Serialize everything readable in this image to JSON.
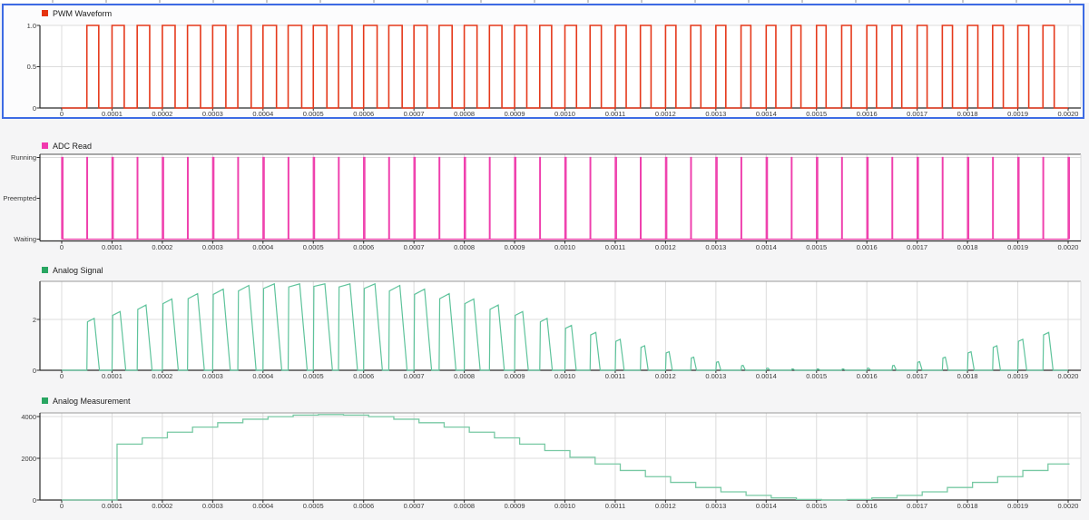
{
  "selection": {
    "selected_panel": "PWM Waveform",
    "border_color": "#3d6be4"
  },
  "colors": {
    "page_bg": "#f5f5f6",
    "plot_bg": "#ffffff",
    "selected_card_bg": "#fcfcfd",
    "grid": "#dcdcdc",
    "axis": "#2b2b2b",
    "tick_text": "#3a3a3a",
    "legend_text": "#1c1c1c"
  },
  "x_axis": {
    "t0": 0,
    "step": 0.0001,
    "t_end": 0.002,
    "labels": [
      "0",
      "0.0001",
      "0.0002",
      "0.0003",
      "0.0004",
      "0.0005",
      "0.0006",
      "0.0007",
      "0.0008",
      "0.0009",
      "0.0010",
      "0.0011",
      "0.0012",
      "0.0013",
      "0.0014",
      "0.0015",
      "0.0016",
      "0.0017",
      "0.0018",
      "0.0019",
      "0.0020"
    ]
  },
  "chart_data": [
    {
      "type": "digital-pwm",
      "title": "PWM Waveform",
      "series_color": "#e5391b",
      "legend_marker_color": "#e5330f",
      "selected": true,
      "ylim": [
        0,
        1
      ],
      "y_ticks": [
        {
          "label": "1.0",
          "v": 1
        },
        {
          "label": "0.5",
          "v": 0.5
        },
        {
          "label": "0",
          "v": 0
        }
      ],
      "signal": {
        "model": "20 kHz PWM: low until 50us, then high-first pulses each 50us period, duty ~46% slightly sine-modulated",
        "period": 5e-05,
        "first_rise": 5e-05,
        "end": 0.002,
        "duty_base": 0.46,
        "duty_mod_amp": 0.08,
        "duty_mod_period": 0.002,
        "low": 0,
        "high": 1
      }
    },
    {
      "type": "digital-task",
      "title": "ADC Read",
      "series_color": "#ef3fad",
      "legend_marker_color": "#f139ae",
      "selected": false,
      "y_ticks": [
        {
          "label": "Running",
          "v": 2
        },
        {
          "label": "Preempted",
          "v": 1
        },
        {
          "label": "Waiting",
          "v": 0
        }
      ],
      "signal": {
        "model": "task state: short spike from Waiting to Running every 50us (alternating spike widths), never Preempted",
        "period": 5e-05,
        "start": 0,
        "end": 0.002,
        "pulse_width_a": 2.4e-06,
        "pulse_width_b": 1.2e-06
      }
    },
    {
      "type": "analog-pulses",
      "title": "Analog Signal",
      "series_color": "#5ec39b",
      "legend_marker_color": "#29a662",
      "selected": false,
      "ylim": [
        0,
        3.5
      ],
      "y_ticks": [
        {
          "label": "2",
          "v": 2
        },
        {
          "label": "0",
          "v": 0
        }
      ],
      "signal": {
        "model": "pulse train every 50us; pulse amplitude/width follow 1.65+1.65*sin(2*pi*t/2ms); fast rise, slanted decay to 0",
        "period": 5e-05,
        "first_pulse": 5e-05,
        "end": 0.002,
        "carrier_offset": 1.65,
        "carrier_amp": 1.65,
        "carrier_period": 0.002
      }
    },
    {
      "type": "staircase",
      "title": "Analog Measurement",
      "series_color": "#78c9a4",
      "legend_marker_color": "#29a662",
      "selected": false,
      "ylim": [
        0,
        4170
      ],
      "y_ticks": [
        {
          "label": "4000",
          "v": 4000
        },
        {
          "label": "2000",
          "v": 2000
        },
        {
          "label": "0",
          "v": 0
        }
      ],
      "signal": {
        "model": "12-bit ADC counts staircase: 2048+2047*sin(2*pi*t/2ms), sampled every 50us, first sample shown at ~110us, 0 before",
        "sample_period": 5e-05,
        "first_sample": 0.0001,
        "latency": 1e-05,
        "end": 0.002,
        "offset": 2048,
        "amp": 2047,
        "sine_period": 0.002
      }
    }
  ]
}
